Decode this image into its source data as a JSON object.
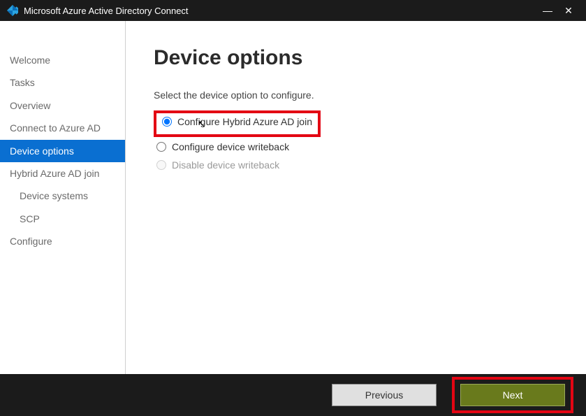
{
  "titlebar": {
    "title": "Microsoft Azure Active Directory Connect"
  },
  "sidebar": {
    "items": [
      {
        "label": "Welcome",
        "sub": false,
        "selected": false
      },
      {
        "label": "Tasks",
        "sub": false,
        "selected": false
      },
      {
        "label": "Overview",
        "sub": false,
        "selected": false
      },
      {
        "label": "Connect to Azure AD",
        "sub": false,
        "selected": false
      },
      {
        "label": "Device options",
        "sub": false,
        "selected": true
      },
      {
        "label": "Hybrid Azure AD join",
        "sub": false,
        "selected": false
      },
      {
        "label": "Device systems",
        "sub": true,
        "selected": false
      },
      {
        "label": "SCP",
        "sub": true,
        "selected": false
      },
      {
        "label": "Configure",
        "sub": false,
        "selected": false
      }
    ]
  },
  "main": {
    "heading": "Device options",
    "prompt": "Select the device option to configure.",
    "options": [
      {
        "label": "Configure Hybrid Azure AD join",
        "checked": true,
        "disabled": false,
        "highlighted": true
      },
      {
        "label": "Configure device writeback",
        "checked": false,
        "disabled": false,
        "highlighted": false
      },
      {
        "label": "Disable device writeback",
        "checked": false,
        "disabled": true,
        "highlighted": false
      }
    ]
  },
  "footer": {
    "previous": "Previous",
    "next": "Next"
  }
}
